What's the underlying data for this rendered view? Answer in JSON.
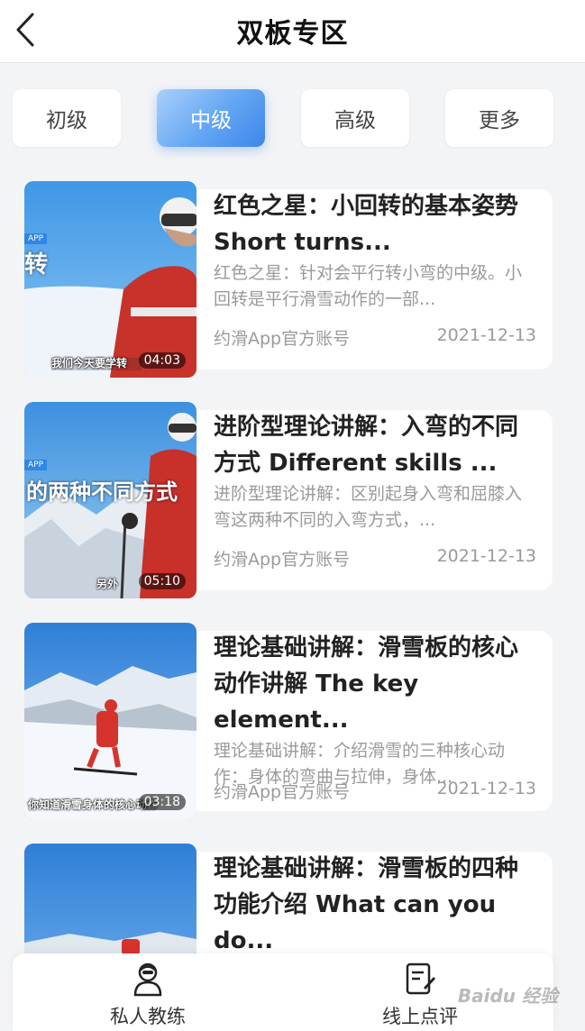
{
  "header": {
    "title": "双板专区"
  },
  "tabs": [
    {
      "label": "初级",
      "active": false
    },
    {
      "label": "中级",
      "active": true
    },
    {
      "label": "高级",
      "active": false
    },
    {
      "label": "更多",
      "active": false
    }
  ],
  "videos": [
    {
      "title": "红色之星：小回转的基本姿势 Short turns...",
      "desc": "红色之星：针对会平行转小弯的中级。小回转是平行滑雪动作的一部...",
      "author": "约滑App官方账号",
      "date": "2021-12-13",
      "duration": "04:03",
      "thumb_overlay": "转",
      "thumb_caption": "我们今天要学转",
      "thumb_tag": "APP"
    },
    {
      "title": "进阶型理论讲解：入弯的不同方式 Different skills ...",
      "desc": "进阶型理论讲解：区别起身入弯和屈膝入弯这两种不同的入弯方式，...",
      "author": "约滑App官方账号",
      "date": "2021-12-13",
      "duration": "05:10",
      "thumb_overlay": "的两种不同方式",
      "thumb_caption": "另外",
      "thumb_tag": "APP"
    },
    {
      "title": "理论基础讲解：滑雪板的核心动作讲解 The key element...",
      "desc": "理论基础讲解：介绍滑雪的三种核心动作：身体的弯曲与拉伸，身体...",
      "author": "约滑App官方账号",
      "date": "2021-12-13",
      "duration": "03:18",
      "thumb_caption": "你知道滑雪身体的核心动作",
      "thumb_tag": ""
    },
    {
      "title": "理论基础讲解：滑雪板的四种功能介绍 What can you do...",
      "desc": "",
      "author": "",
      "date": "",
      "duration": "",
      "thumb_caption": "",
      "thumb_tag": ""
    }
  ],
  "bottom_nav": [
    {
      "label": "私人教练",
      "icon": "coach-icon"
    },
    {
      "label": "线上点评",
      "icon": "review-icon"
    }
  ],
  "watermark": "Baidu 经验",
  "colors": {
    "accent": "#3f86ea",
    "accent_light": "#a9d0fb",
    "background": "#f3f4f6",
    "card": "#ffffff",
    "muted_text": "#9a9a9a"
  }
}
